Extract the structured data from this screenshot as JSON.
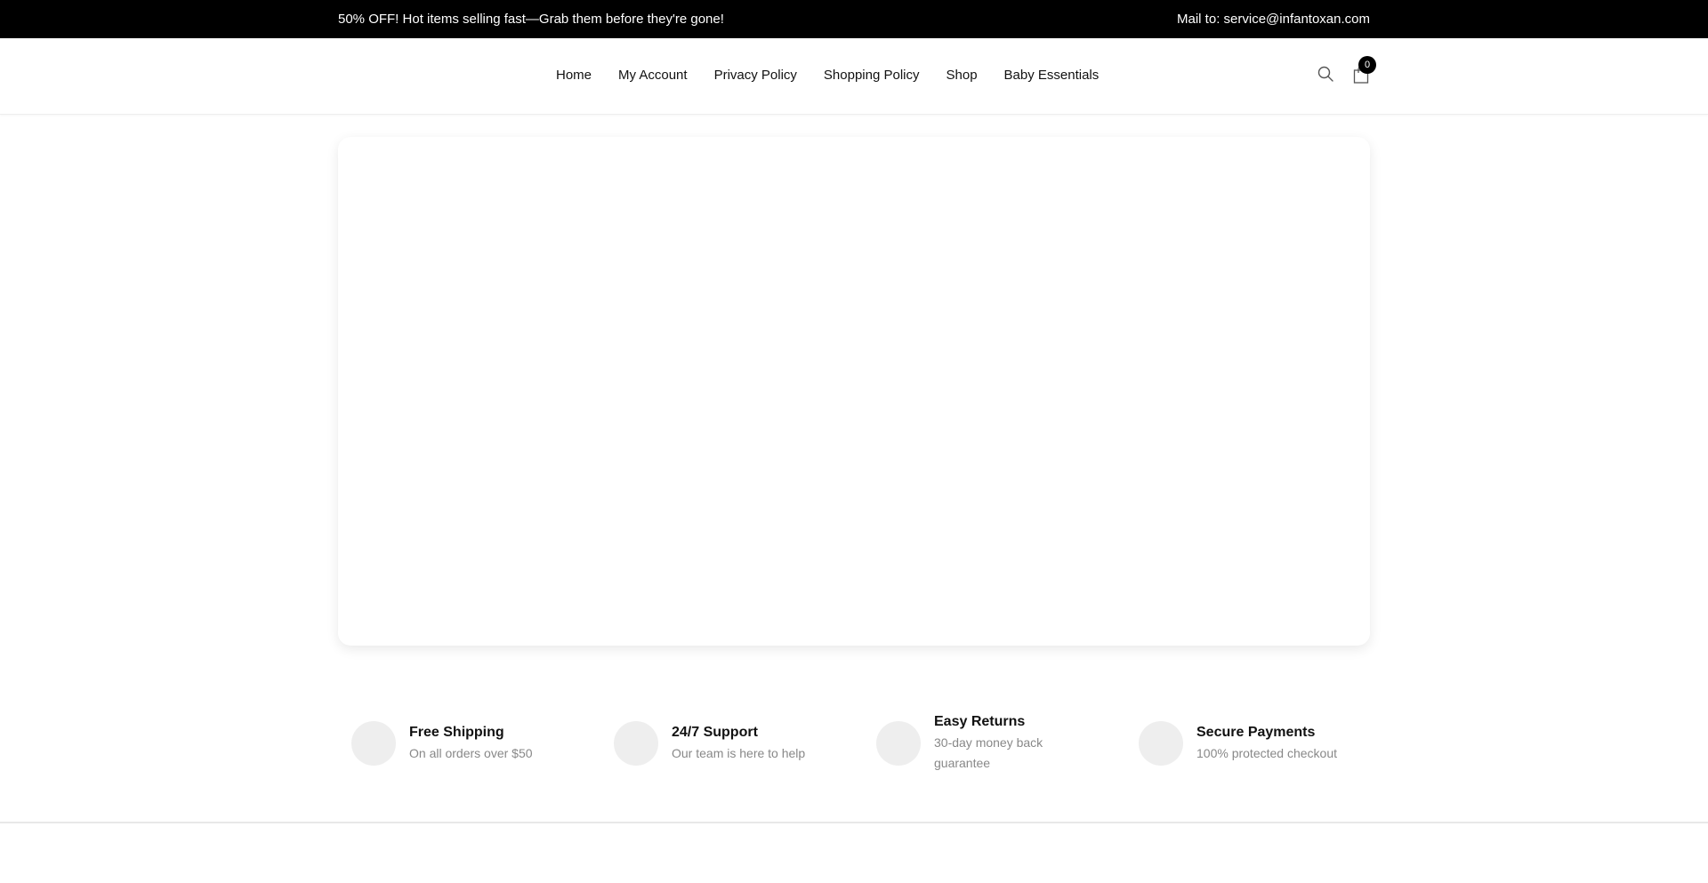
{
  "topbar": {
    "promo": "50% OFF! Hot items selling fast—Grab them before they're gone!",
    "mail": "Mail to: service@infantoxan.com"
  },
  "nav": {
    "items": [
      {
        "label": "Home"
      },
      {
        "label": "My Account"
      },
      {
        "label": "Privacy Policy"
      },
      {
        "label": "Shopping Policy"
      },
      {
        "label": "Shop"
      },
      {
        "label": "Baby Essentials"
      }
    ]
  },
  "header": {
    "search_icon": "search-icon",
    "cart_icon": "shopping-bag-icon",
    "cart_count": "0"
  },
  "features": [
    {
      "title": "Free Shipping",
      "desc": "On all orders over $50"
    },
    {
      "title": "24/7 Support",
      "desc": "Our team is here to help"
    },
    {
      "title": "Easy Returns",
      "desc": "30-day money back guarantee"
    },
    {
      "title": "Secure Payments",
      "desc": "100% protected checkout"
    }
  ],
  "colors": {
    "topbar_bg": "#000000",
    "topbar_text": "#ffffff",
    "icon_placeholder": "#eeeeee",
    "muted_text": "#888888"
  }
}
